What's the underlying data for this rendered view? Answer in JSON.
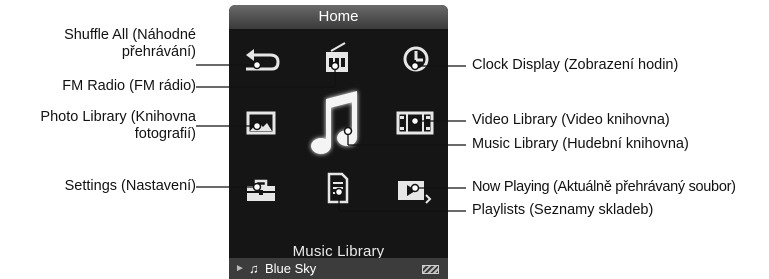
{
  "screen": {
    "title": "Home",
    "selected_label": "Music Library",
    "now_playing_bar": {
      "play_glyph": "►",
      "note_glyph": "♫",
      "track": "Blue Sky"
    }
  },
  "callouts": {
    "shuffle_all": {
      "line1": "Shuffle All (Náhodné",
      "line2": "přehrávání)"
    },
    "fm_radio": "FM Radio (FM rádio)",
    "photo_library": {
      "line1": "Photo Library (Knihovna",
      "line2": "fotografií)"
    },
    "settings": "Settings (Nastavení)",
    "clock_display": "Clock Display (Zobrazení hodin)",
    "video_library": "Video Library (Video knihovna)",
    "music_library": "Music Library (Hudební knihovna)",
    "now_playing": "Now Playing (Aktuálně přehrávaný soubor)",
    "playlists": "Playlists (Seznamy skladeb)"
  },
  "icons": [
    "shuffle-icon",
    "fm-radio-icon",
    "clock-icon",
    "photo-icon",
    "music-note-icon",
    "video-icon",
    "settings-icon",
    "playlist-icon",
    "now-playing-icon",
    "battery-icon"
  ],
  "colors": {
    "screen": "#151515",
    "titlebar": "#4a4a4a",
    "icon": "#e6e6e6",
    "text": "#111111"
  }
}
